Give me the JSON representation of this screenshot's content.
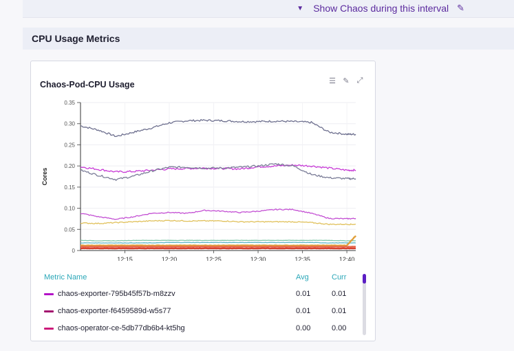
{
  "header": {
    "chaos_toggle_label": "Show Chaos during this interval",
    "caret_icon": "caret-down-icon",
    "edit_icon": "pencil-icon"
  },
  "section": {
    "title": "CPU Usage Metrics"
  },
  "panel": {
    "title": "Chaos-Pod-CPU Usage",
    "tools": [
      "list-icon",
      "pencil-icon",
      "expand-icon"
    ]
  },
  "legend": {
    "headers": {
      "name": "Metric Name",
      "avg": "Avg",
      "curr": "Curr"
    },
    "rows": [
      {
        "name": "chaos-exporter-795b45f57b-m8zzv",
        "avg": "0.01",
        "curr": "0.01",
        "color": "#b312c7"
      },
      {
        "name": "chaos-exporter-f6459589d-w5s77",
        "avg": "0.01",
        "curr": "0.01",
        "color": "#a3126e"
      },
      {
        "name": "chaos-operator-ce-5db77db6b4-kt5hg",
        "avg": "0.00",
        "curr": "0.00",
        "color": "#cc1a7a"
      }
    ]
  },
  "chart_data": {
    "type": "line",
    "ylabel": "Cores",
    "xlabel": "",
    "ylim": [
      0,
      0.35
    ],
    "yticks": [
      "0",
      "0.05",
      "0.10",
      "0.15",
      "0.20",
      "0.25",
      "0.30",
      "0.35"
    ],
    "xticks": [
      "12:15",
      "12:20",
      "12:25",
      "12:30",
      "12:35",
      "12:40"
    ],
    "x": [
      "12:10",
      "12:12",
      "12:14",
      "12:16",
      "12:18",
      "12:20",
      "12:22",
      "12:24",
      "12:26",
      "12:28",
      "12:30",
      "12:32",
      "12:34",
      "12:36",
      "12:38",
      "12:40",
      "12:41"
    ],
    "series": [
      {
        "color": "#6d6f8e",
        "values": [
          0.295,
          0.285,
          0.27,
          0.28,
          0.29,
          0.302,
          0.307,
          0.308,
          0.307,
          0.305,
          0.305,
          0.306,
          0.305,
          0.303,
          0.28,
          0.275,
          0.275
        ]
      },
      {
        "color": "#c73ad6",
        "values": [
          0.198,
          0.192,
          0.186,
          0.187,
          0.19,
          0.193,
          0.194,
          0.195,
          0.194,
          0.193,
          0.198,
          0.2,
          0.202,
          0.2,
          0.195,
          0.19,
          0.19
        ]
      },
      {
        "color": "#7a7c97",
        "values": [
          0.19,
          0.178,
          0.168,
          0.176,
          0.188,
          0.197,
          0.197,
          0.195,
          0.195,
          0.197,
          0.2,
          0.205,
          0.2,
          0.18,
          0.172,
          0.17,
          0.17
        ]
      },
      {
        "color": "#c34fd3",
        "values": [
          0.088,
          0.08,
          0.074,
          0.08,
          0.088,
          0.09,
          0.088,
          0.095,
          0.093,
          0.09,
          0.093,
          0.097,
          0.097,
          0.088,
          0.076,
          0.075,
          0.076
        ]
      },
      {
        "color": "#e0c05a",
        "values": [
          0.065,
          0.064,
          0.066,
          0.068,
          0.07,
          0.071,
          0.07,
          0.07,
          0.07,
          0.068,
          0.068,
          0.068,
          0.068,
          0.066,
          0.062,
          0.062,
          0.062
        ]
      },
      {
        "color": "#7fc8a8",
        "values": [
          0.024,
          0.023,
          0.023,
          0.024,
          0.024,
          0.024,
          0.024,
          0.024,
          0.024,
          0.024,
          0.024,
          0.024,
          0.024,
          0.024,
          0.024,
          0.023,
          0.023
        ]
      },
      {
        "color": "#5db5c7",
        "values": [
          0.018,
          0.018,
          0.018,
          0.018,
          0.018,
          0.019,
          0.019,
          0.019,
          0.019,
          0.019,
          0.019,
          0.019,
          0.019,
          0.019,
          0.018,
          0.018,
          0.018
        ]
      },
      {
        "color": "#e0a03a",
        "values": [
          0.012,
          0.012,
          0.012,
          0.012,
          0.012,
          0.012,
          0.012,
          0.012,
          0.012,
          0.012,
          0.012,
          0.012,
          0.012,
          0.012,
          0.012,
          0.012,
          0.035
        ]
      },
      {
        "color": "#e76a4e",
        "values": [
          0.009,
          0.009,
          0.009,
          0.009,
          0.009,
          0.009,
          0.009,
          0.009,
          0.009,
          0.009,
          0.009,
          0.009,
          0.009,
          0.009,
          0.009,
          0.009,
          0.009
        ]
      },
      {
        "color": "#d6402e",
        "values": [
          0.005,
          0.005,
          0.005,
          0.005,
          0.005,
          0.005,
          0.005,
          0.005,
          0.005,
          0.005,
          0.005,
          0.005,
          0.005,
          0.005,
          0.005,
          0.005,
          0.005
        ]
      }
    ]
  }
}
